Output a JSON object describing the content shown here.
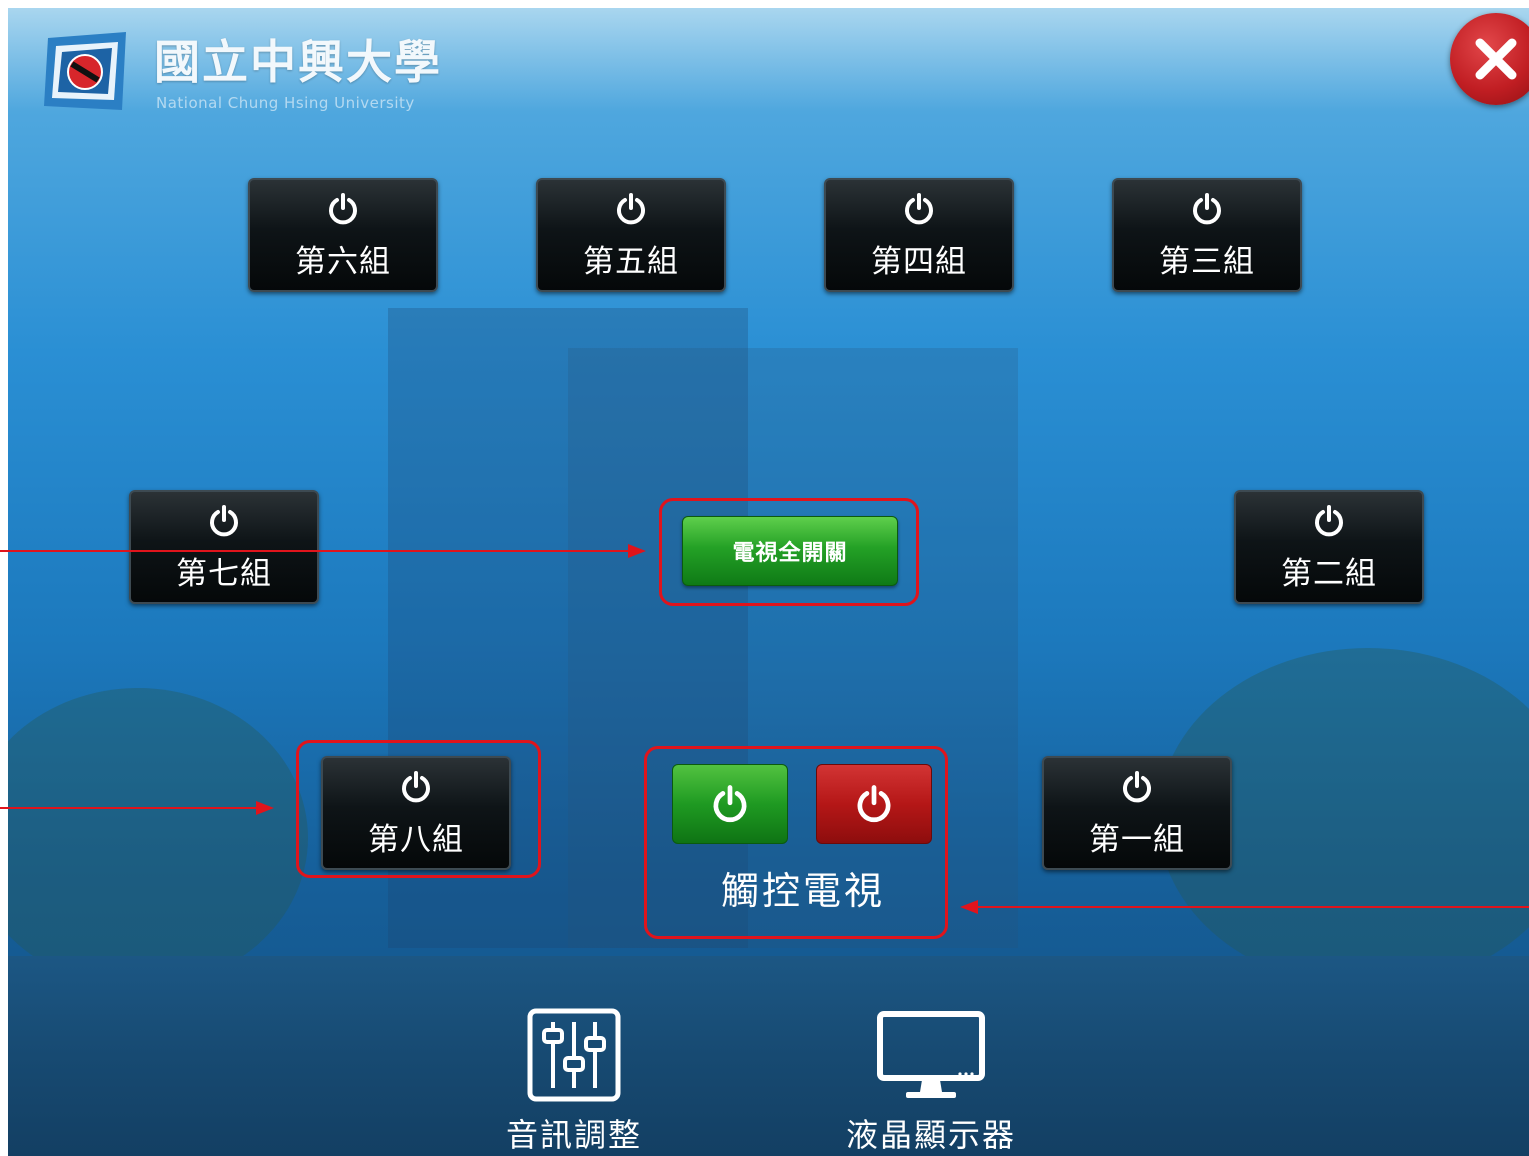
{
  "header": {
    "logo_title": "國立中興大學",
    "logo_subtitle": "National Chung Hsing University",
    "close_icon": "close-icon"
  },
  "groups": {
    "g6": "第六組",
    "g5": "第五組",
    "g4": "第四組",
    "g3": "第三組",
    "g7": "第七組",
    "g2": "第二組",
    "g8": "第八組",
    "g1": "第一組"
  },
  "center": {
    "all_tv_label": "電視全開關",
    "touch_tv_label": "觸控電視"
  },
  "footer": {
    "audio_label": "音訊調整",
    "lcd_label": "液晶顯示器"
  },
  "colors": {
    "highlight": "#e0141c",
    "on_green": "#1f9a22",
    "off_red": "#b51717"
  }
}
